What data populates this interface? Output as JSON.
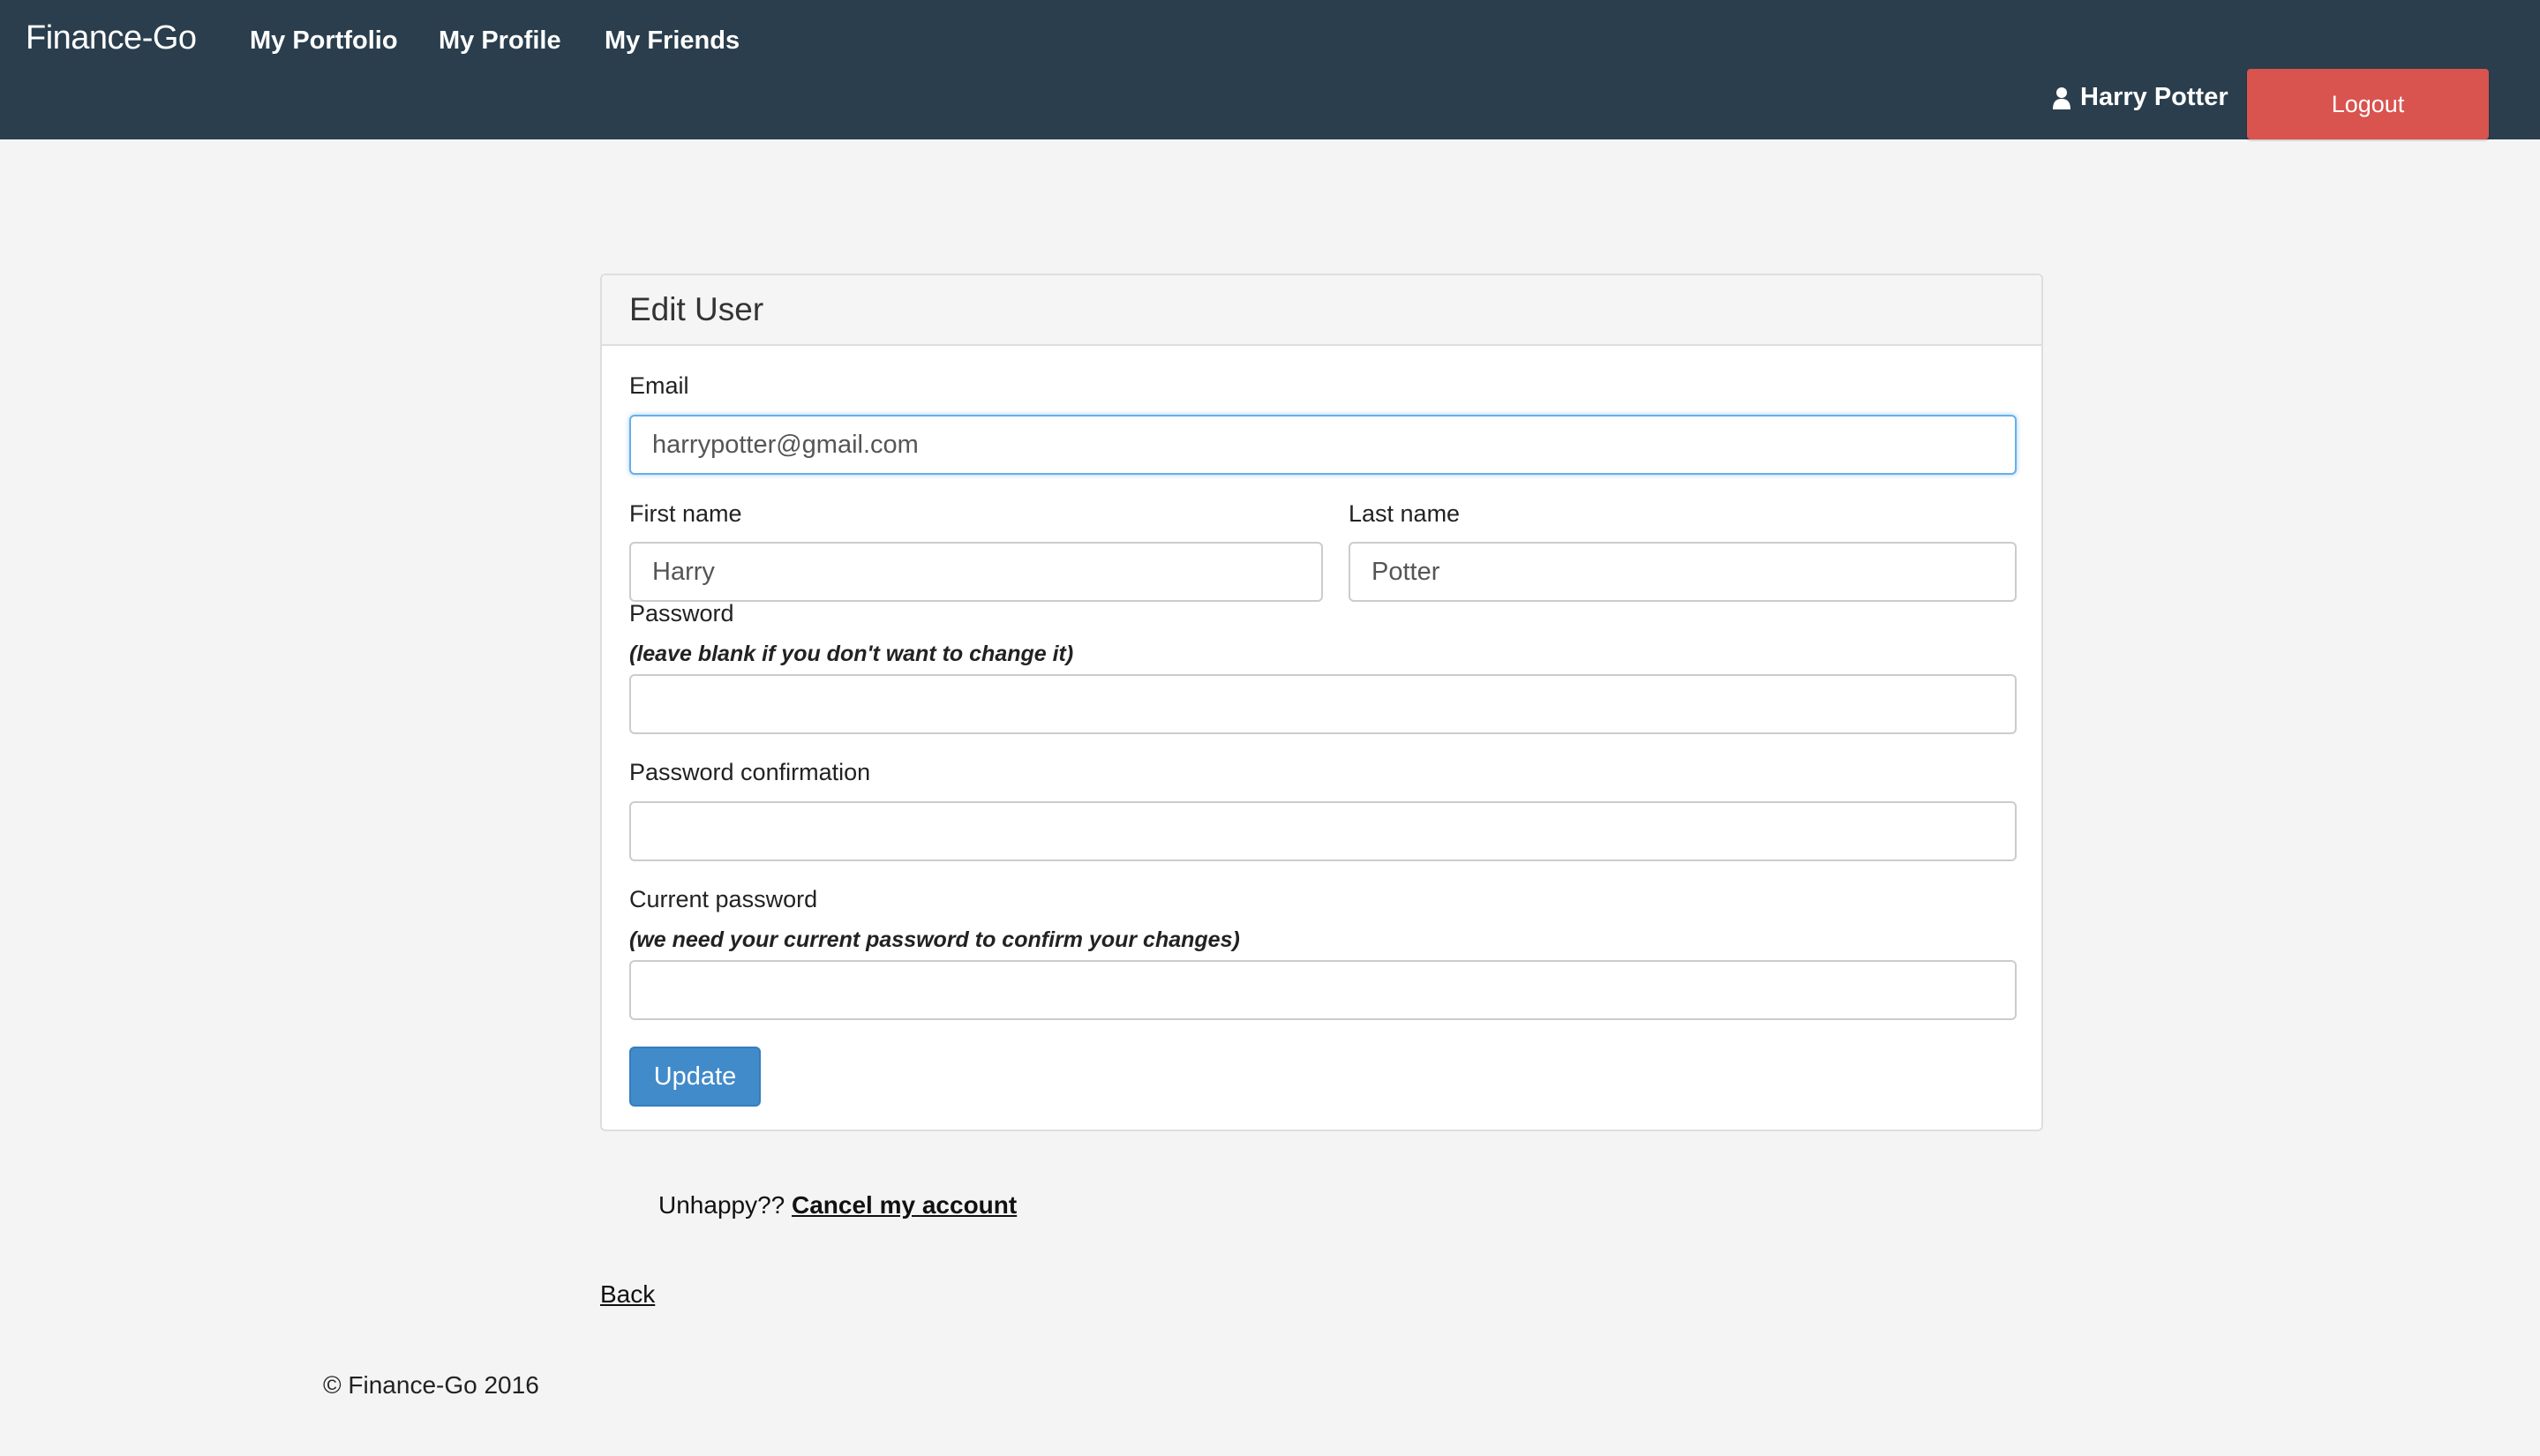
{
  "navbar": {
    "brand": "Finance-Go",
    "links": [
      "My Portfolio",
      "My Profile",
      "My Friends"
    ],
    "user_name": "Harry Potter",
    "user_icon": "user-icon",
    "logout_label": "Logout",
    "background": "#2a3e4d",
    "logout_color": "#d9534f"
  },
  "panel": {
    "title": "Edit User",
    "email_label": "Email",
    "email_value": "harrypotter@gmail.com",
    "first_name_label": "First name",
    "first_name_value": "Harry",
    "last_name_label": "Last name",
    "last_name_value": "Potter",
    "password_label": "Password",
    "password_hint": "(leave blank if you don't want to change it)",
    "password_confirmation_label": "Password confirmation",
    "current_password_label": "Current password",
    "current_password_hint": "(we need your current password to confirm your changes)",
    "update_label": "Update",
    "update_color": "#428bca"
  },
  "cancel": {
    "prefix": "Unhappy??",
    "link": "Cancel my account"
  },
  "back_label": "Back",
  "footer": "© Finance-Go 2016"
}
